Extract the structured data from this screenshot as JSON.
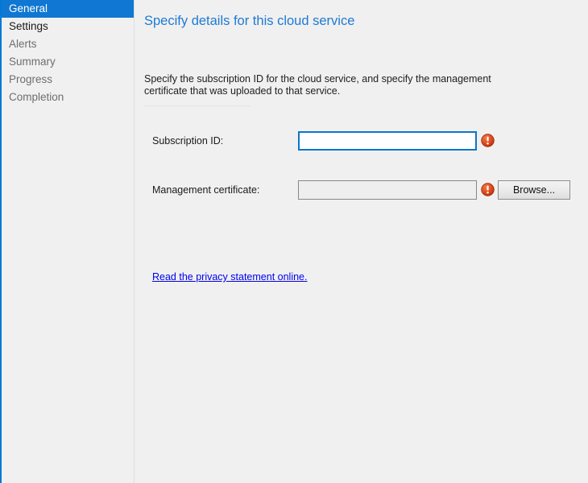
{
  "window": {
    "accent_color": "#0078d7",
    "background_color": "#f0f0f0"
  },
  "sidebar": {
    "items": [
      {
        "label": "General",
        "state": "current"
      },
      {
        "label": "Settings",
        "state": "completed"
      },
      {
        "label": "Alerts",
        "state": "pending"
      },
      {
        "label": "Summary",
        "state": "pending"
      },
      {
        "label": "Progress",
        "state": "pending"
      },
      {
        "label": "Completion",
        "state": "pending"
      }
    ],
    "selected_color": "#1077d2",
    "selected_text_color": "#ffffff"
  },
  "content": {
    "title": "Specify details for this cloud service",
    "title_color": "#1d7ad4",
    "intro": "Specify the subscription ID for the cloud service, and specify the management certificate that was uploaded to that service.",
    "fields": {
      "subscription": {
        "label": "Subscription ID:",
        "value": "",
        "placeholder": "",
        "focused": true,
        "validation_icon": "error-icon",
        "validation_color": "#d9441d"
      },
      "certificate": {
        "label": "Management certificate:",
        "value": "",
        "placeholder": "",
        "focused": false,
        "validation_icon": "error-icon",
        "validation_color": "#d9441d",
        "browse_label": "Browse..."
      }
    },
    "privacy_link": {
      "label": "Read the privacy statement online.",
      "color": "#0000ee"
    }
  }
}
